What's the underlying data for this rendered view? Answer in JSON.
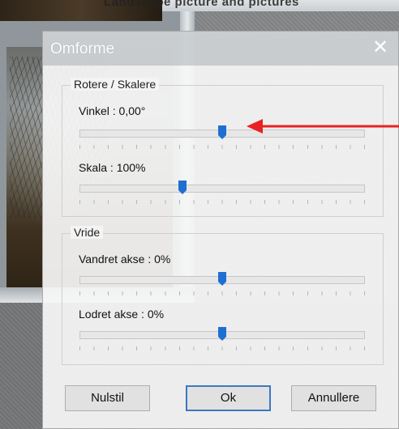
{
  "background": {
    "top_text": "Landscape picture and pictures"
  },
  "dialog": {
    "title": "Omforme",
    "close_glyph": "✕",
    "rotate_scale": {
      "legend": "Rotere / Skalere",
      "angle": {
        "label": "Vinkel : 0,00°",
        "position": 0.5
      },
      "scale": {
        "label": "Skala : 100%",
        "position": 0.36
      }
    },
    "skew": {
      "legend": "Vride",
      "horizontal": {
        "label": "Vandret akse : 0%",
        "position": 0.5
      },
      "vertical": {
        "label": "Lodret akse : 0%",
        "position": 0.5
      }
    },
    "buttons": {
      "reset": "Nulstil",
      "ok": "Ok",
      "cancel": "Annullere"
    }
  },
  "colors": {
    "accent": "#1f6fd1",
    "annotation_arrow": "#e82222",
    "primary_border": "#3b78c2"
  },
  "icons": {
    "close": "close-icon",
    "slider_thumb": "slider-thumb-icon",
    "annotation": "red-arrow-icon"
  }
}
